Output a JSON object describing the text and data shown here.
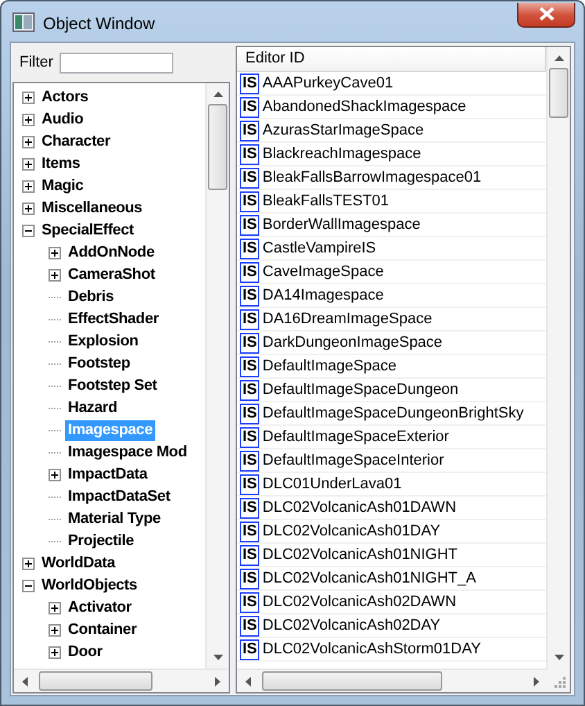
{
  "window": {
    "title": "Object Window"
  },
  "filter": {
    "label": "Filter"
  },
  "tree": [
    {
      "label": "Actors",
      "kind": "folder",
      "expanded": false,
      "selected": false
    },
    {
      "label": "Audio",
      "kind": "folder",
      "expanded": false,
      "selected": false
    },
    {
      "label": "Character",
      "kind": "folder",
      "expanded": false,
      "selected": false
    },
    {
      "label": "Items",
      "kind": "folder",
      "expanded": false,
      "selected": false
    },
    {
      "label": "Magic",
      "kind": "folder",
      "expanded": false,
      "selected": false
    },
    {
      "label": "Miscellaneous",
      "kind": "folder",
      "expanded": false,
      "selected": false
    },
    {
      "label": "SpecialEffect",
      "kind": "folder",
      "expanded": true,
      "selected": false,
      "children": [
        {
          "label": "AddOnNode",
          "kind": "folder",
          "expanded": false,
          "selected": false
        },
        {
          "label": "CameraShot",
          "kind": "folder",
          "expanded": false,
          "selected": false
        },
        {
          "label": "Debris",
          "kind": "leaf",
          "selected": false
        },
        {
          "label": "EffectShader",
          "kind": "leaf",
          "selected": false
        },
        {
          "label": "Explosion",
          "kind": "leaf",
          "selected": false
        },
        {
          "label": "Footstep",
          "kind": "leaf",
          "selected": false
        },
        {
          "label": "Footstep Set",
          "kind": "leaf",
          "selected": false
        },
        {
          "label": "Hazard",
          "kind": "leaf",
          "selected": false
        },
        {
          "label": "Imagespace",
          "kind": "leaf",
          "selected": true
        },
        {
          "label": "Imagespace Mod",
          "kind": "leaf",
          "selected": false
        },
        {
          "label": "ImpactData",
          "kind": "folder",
          "expanded": false,
          "selected": false
        },
        {
          "label": "ImpactDataSet",
          "kind": "leaf",
          "selected": false
        },
        {
          "label": "Material Type",
          "kind": "leaf",
          "selected": false
        },
        {
          "label": "Projectile",
          "kind": "leaf",
          "selected": false
        }
      ]
    },
    {
      "label": "WorldData",
      "kind": "folder",
      "expanded": false,
      "selected": false
    },
    {
      "label": "WorldObjects",
      "kind": "folder",
      "expanded": true,
      "selected": false,
      "children": [
        {
          "label": "Activator",
          "kind": "folder",
          "expanded": false,
          "selected": false
        },
        {
          "label": "Container",
          "kind": "folder",
          "expanded": false,
          "selected": false
        },
        {
          "label": "Door",
          "kind": "folder",
          "expanded": false,
          "selected": false
        }
      ]
    }
  ],
  "list": {
    "columns": [
      "Editor ID"
    ],
    "rows": [
      {
        "icon": "IS",
        "editor_id": "AAAPurkeyCave01"
      },
      {
        "icon": "IS",
        "editor_id": "AbandonedShackImagespace"
      },
      {
        "icon": "IS",
        "editor_id": "AzurasStarImageSpace"
      },
      {
        "icon": "IS",
        "editor_id": "BlackreachImagespace"
      },
      {
        "icon": "IS",
        "editor_id": "BleakFallsBarrowImagespace01"
      },
      {
        "icon": "IS",
        "editor_id": "BleakFallsTEST01"
      },
      {
        "icon": "IS",
        "editor_id": "BorderWallImagespace"
      },
      {
        "icon": "IS",
        "editor_id": "CastleVampireIS"
      },
      {
        "icon": "IS",
        "editor_id": "CaveImageSpace"
      },
      {
        "icon": "IS",
        "editor_id": "DA14Imagespace"
      },
      {
        "icon": "IS",
        "editor_id": "DA16DreamImageSpace"
      },
      {
        "icon": "IS",
        "editor_id": "DarkDungeonImageSpace"
      },
      {
        "icon": "IS",
        "editor_id": "DefaultImageSpace"
      },
      {
        "icon": "IS",
        "editor_id": "DefaultImageSpaceDungeon"
      },
      {
        "icon": "IS",
        "editor_id": "DefaultImageSpaceDungeonBrightSky"
      },
      {
        "icon": "IS",
        "editor_id": "DefaultImageSpaceExterior"
      },
      {
        "icon": "IS",
        "editor_id": "DefaultImageSpaceInterior"
      },
      {
        "icon": "IS",
        "editor_id": "DLC01UnderLava01"
      },
      {
        "icon": "IS",
        "editor_id": "DLC02VolcanicAsh01DAWN"
      },
      {
        "icon": "IS",
        "editor_id": "DLC02VolcanicAsh01DAY"
      },
      {
        "icon": "IS",
        "editor_id": "DLC02VolcanicAsh01NIGHT"
      },
      {
        "icon": "IS",
        "editor_id": "DLC02VolcanicAsh01NIGHT_A"
      },
      {
        "icon": "IS",
        "editor_id": "DLC02VolcanicAsh02DAWN"
      },
      {
        "icon": "IS",
        "editor_id": "DLC02VolcanicAsh02DAY"
      },
      {
        "icon": "IS",
        "editor_id": "DLC02VolcanicAshStorm01DAY"
      }
    ]
  }
}
